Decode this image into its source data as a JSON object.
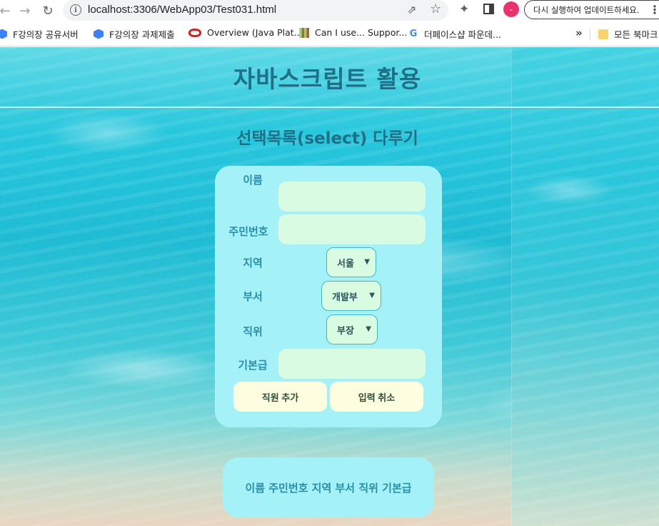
{
  "browser": {
    "url": "localhost:3306/WebApp03/Test031.html",
    "profile_initial": "-",
    "update_button": "다시 실행하여 업데이트하세요."
  },
  "bookmarks": [
    {
      "label": "F강의장 공유서버",
      "icon": "hexagon-icon"
    },
    {
      "label": "F강의장 과제제출",
      "icon": "hexagon-icon"
    },
    {
      "label": "Overview (Java Plat...",
      "icon": "oracle-icon"
    },
    {
      "label": "Can I use... Suppor...",
      "icon": "caniuse-icon"
    },
    {
      "label": "더페이스샵 파운데...",
      "icon": "google-icon"
    }
  ],
  "bookmarks_more": "»",
  "bookmarks_folder": "모든 북마크",
  "page": {
    "title": "자바스크립트 활용",
    "section_title": "선택목록(select) 다루기"
  },
  "form": {
    "name_label": "이름",
    "name_value": "",
    "ssn_label": "주민번호",
    "ssn_value": "",
    "region_label": "지역",
    "region_selected": "서울",
    "dept_label": "부서",
    "dept_selected": "개발부",
    "position_label": "직위",
    "position_selected": "부장",
    "salary_label": "기본급",
    "salary_value": "",
    "add_button": "직원 추가",
    "cancel_button": "입력 취소"
  },
  "output": {
    "header_text": "이름 주민번호 지역 부서 직위 기본급"
  },
  "colors": {
    "title": "#1f6f86",
    "card": "#a4f2f8",
    "input_bg": "#d9fbe2",
    "button_bg": "#fdfde0",
    "label": "#2a8ea8"
  }
}
